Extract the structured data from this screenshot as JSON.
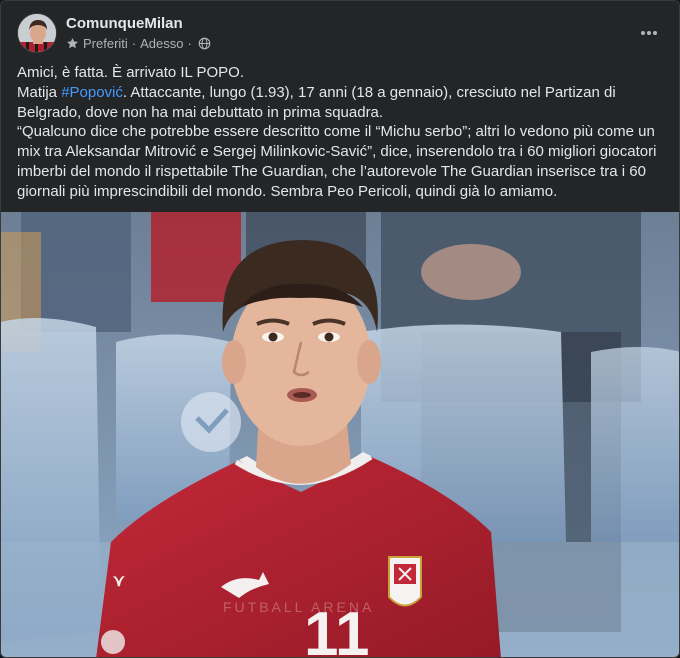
{
  "post": {
    "author": "ComunqueMilan",
    "audience_label": "Preferiti",
    "time": "Adesso",
    "separator": "·",
    "avatar_icon": "profile-photo",
    "more_icon": "more-horizontal-icon",
    "audience_icon": "globe-icon",
    "favorite_icon": "star-icon"
  },
  "text": {
    "line1": "Amici, è fatta. È arrivato IL POPO.",
    "line2_before": "Matija ",
    "hashtag": "#Popović",
    "line2_after": ". Attaccante, lungo (1.93), 17 anni (18 a gennaio), cresciuto nel Partizan di Belgrado, dove non ha mai debuttato in prima squadra.",
    "paragraph": "“Qualcuno dice che potrebbe essere descritto come il “Michu serbo”; altri lo vedono più come un mix tra Aleksandar Mitrović e Sergej Milinkovic-Savić”, dice, inserendolo tra i 60 migliori giocatori imberbi del mondo il rispettabile The Guardian, che l’autorevole The Guardian inserisce tra i 60 giornali più imprescindibili del mondo. Sembra Peo Pericoli, quindi già lo amiamo."
  },
  "photo": {
    "shirt_number": "11",
    "watermark": "FUTBALL ARENA",
    "colors": {
      "shirt": "#b5202e",
      "stands": "#9db8d6",
      "skin": "#e2b49a",
      "hair": "#3b2a20"
    }
  },
  "theme": {
    "card_bg": "#242526",
    "text": "#e4e6eb",
    "secondary": "#b0b3b8",
    "link": "#4599ff"
  }
}
